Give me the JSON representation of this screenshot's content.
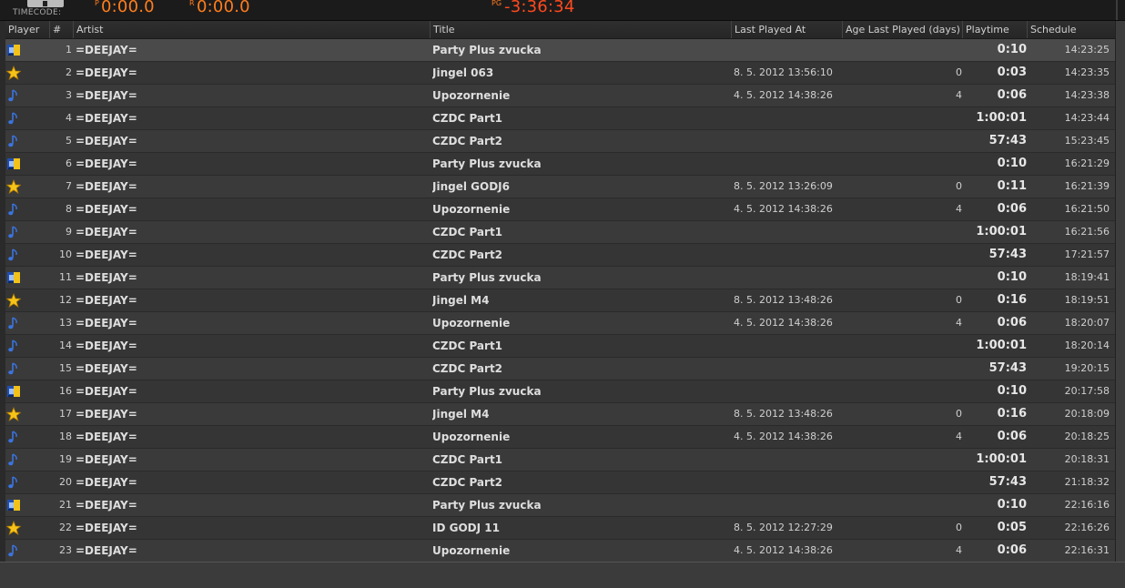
{
  "topbar": {
    "timecode_label": "TIMECODE:",
    "time1_prefix": "P",
    "time1": "0:00.0",
    "time2_prefix": "R",
    "time2": "0:00.0",
    "time3_prefix": "PG",
    "time3": "-3:36:34"
  },
  "columns": {
    "player": "Player",
    "num": "#",
    "artist": "Artist",
    "title": "Title",
    "last_played": "Last Played At",
    "age": "Age Last Played (days)",
    "playtime": "Playtime",
    "schedule": "Schedule"
  },
  "colors": {
    "accent_orange": "#ff7d1e",
    "accent_red": "#ff4a1e",
    "icon_blue": "#2d6bd6",
    "icon_yellow": "#f2c21b"
  },
  "rows": [
    {
      "icon": "promo-icon",
      "num": "1",
      "artist": "=DEEJAY=",
      "title": "Party Plus zvucka",
      "last": "",
      "age": "",
      "play": "0:10",
      "sched": "14:23:25"
    },
    {
      "icon": "star-icon",
      "num": "2",
      "artist": "=DEEJAY=",
      "title": "Jingel 063",
      "last": "8. 5. 2012 13:56:10",
      "age": "0",
      "play": "0:03",
      "sched": "14:23:35"
    },
    {
      "icon": "music-note-icon",
      "num": "3",
      "artist": "=DEEJAY=",
      "title": "Upozornenie",
      "last": "4. 5. 2012 14:38:26",
      "age": "4",
      "play": "0:06",
      "sched": "14:23:38"
    },
    {
      "icon": "music-note-icon",
      "num": "4",
      "artist": "=DEEJAY=",
      "title": "CZDC Part1",
      "last": "",
      "age": "",
      "play": "1:00:01",
      "sched": "14:23:44"
    },
    {
      "icon": "music-note-icon",
      "num": "5",
      "artist": "=DEEJAY=",
      "title": "CZDC Part2",
      "last": "",
      "age": "",
      "play": "57:43",
      "sched": "15:23:45"
    },
    {
      "icon": "promo-icon",
      "num": "6",
      "artist": "=DEEJAY=",
      "title": "Party Plus zvucka",
      "last": "",
      "age": "",
      "play": "0:10",
      "sched": "16:21:29"
    },
    {
      "icon": "star-icon",
      "num": "7",
      "artist": "=DEEJAY=",
      "title": "Jingel GODJ6",
      "last": "8. 5. 2012 13:26:09",
      "age": "0",
      "play": "0:11",
      "sched": "16:21:39"
    },
    {
      "icon": "music-note-icon",
      "num": "8",
      "artist": "=DEEJAY=",
      "title": "Upozornenie",
      "last": "4. 5. 2012 14:38:26",
      "age": "4",
      "play": "0:06",
      "sched": "16:21:50"
    },
    {
      "icon": "music-note-icon",
      "num": "9",
      "artist": "=DEEJAY=",
      "title": "CZDC Part1",
      "last": "",
      "age": "",
      "play": "1:00:01",
      "sched": "16:21:56"
    },
    {
      "icon": "music-note-icon",
      "num": "10",
      "artist": "=DEEJAY=",
      "title": "CZDC Part2",
      "last": "",
      "age": "",
      "play": "57:43",
      "sched": "17:21:57"
    },
    {
      "icon": "promo-icon",
      "num": "11",
      "artist": "=DEEJAY=",
      "title": "Party Plus zvucka",
      "last": "",
      "age": "",
      "play": "0:10",
      "sched": "18:19:41"
    },
    {
      "icon": "star-icon",
      "num": "12",
      "artist": "=DEEJAY=",
      "title": "Jingel M4",
      "last": "8. 5. 2012 13:48:26",
      "age": "0",
      "play": "0:16",
      "sched": "18:19:51"
    },
    {
      "icon": "music-note-icon",
      "num": "13",
      "artist": "=DEEJAY=",
      "title": "Upozornenie",
      "last": "4. 5. 2012 14:38:26",
      "age": "4",
      "play": "0:06",
      "sched": "18:20:07"
    },
    {
      "icon": "music-note-icon",
      "num": "14",
      "artist": "=DEEJAY=",
      "title": "CZDC Part1",
      "last": "",
      "age": "",
      "play": "1:00:01",
      "sched": "18:20:14"
    },
    {
      "icon": "music-note-icon",
      "num": "15",
      "artist": "=DEEJAY=",
      "title": "CZDC Part2",
      "last": "",
      "age": "",
      "play": "57:43",
      "sched": "19:20:15"
    },
    {
      "icon": "promo-icon",
      "num": "16",
      "artist": "=DEEJAY=",
      "title": "Party Plus zvucka",
      "last": "",
      "age": "",
      "play": "0:10",
      "sched": "20:17:58"
    },
    {
      "icon": "star-icon",
      "num": "17",
      "artist": "=DEEJAY=",
      "title": "Jingel M4",
      "last": "8. 5. 2012 13:48:26",
      "age": "0",
      "play": "0:16",
      "sched": "20:18:09"
    },
    {
      "icon": "music-note-icon",
      "num": "18",
      "artist": "=DEEJAY=",
      "title": "Upozornenie",
      "last": "4. 5. 2012 14:38:26",
      "age": "4",
      "play": "0:06",
      "sched": "20:18:25"
    },
    {
      "icon": "music-note-icon",
      "num": "19",
      "artist": "=DEEJAY=",
      "title": "CZDC Part1",
      "last": "",
      "age": "",
      "play": "1:00:01",
      "sched": "20:18:31"
    },
    {
      "icon": "music-note-icon",
      "num": "20",
      "artist": "=DEEJAY=",
      "title": "CZDC Part2",
      "last": "",
      "age": "",
      "play": "57:43",
      "sched": "21:18:32"
    },
    {
      "icon": "promo-icon",
      "num": "21",
      "artist": "=DEEJAY=",
      "title": "Party Plus zvucka",
      "last": "",
      "age": "",
      "play": "0:10",
      "sched": "22:16:16"
    },
    {
      "icon": "star-icon",
      "num": "22",
      "artist": "=DEEJAY=",
      "title": "ID GODJ 11",
      "last": "8. 5. 2012 12:27:29",
      "age": "0",
      "play": "0:05",
      "sched": "22:16:26"
    },
    {
      "icon": "music-note-icon",
      "num": "23",
      "artist": "=DEEJAY=",
      "title": "Upozornenie",
      "last": "4. 5. 2012 14:38:26",
      "age": "4",
      "play": "0:06",
      "sched": "22:16:31"
    }
  ]
}
